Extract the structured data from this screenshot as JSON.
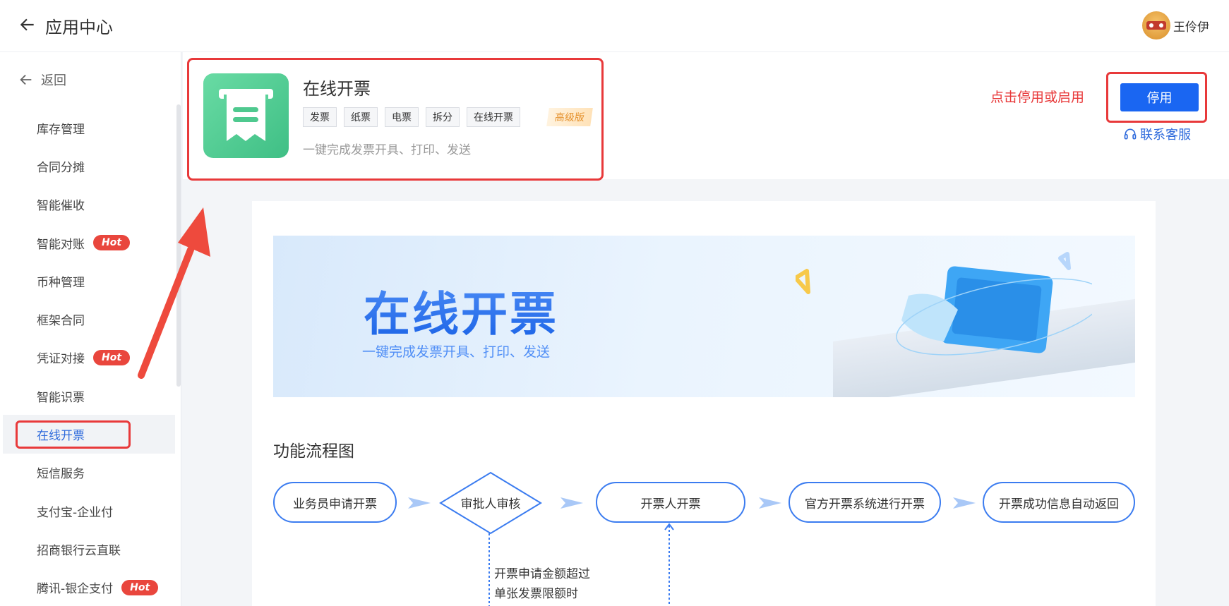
{
  "header": {
    "title": "应用中心",
    "user_name": "王伶伊"
  },
  "sidebar": {
    "back_label": "返回",
    "items": [
      {
        "label": "库存管理",
        "hot": ""
      },
      {
        "label": "合同分摊",
        "hot": ""
      },
      {
        "label": "智能催收",
        "hot": ""
      },
      {
        "label": "智能对账",
        "hot": "Hot"
      },
      {
        "label": "币种管理",
        "hot": ""
      },
      {
        "label": "框架合同",
        "hot": ""
      },
      {
        "label": "凭证对接",
        "hot": "Hot"
      },
      {
        "label": "智能识票",
        "hot": ""
      },
      {
        "label": "在线开票",
        "hot": ""
      },
      {
        "label": "短信服务",
        "hot": ""
      },
      {
        "label": "支付宝-企业付",
        "hot": ""
      },
      {
        "label": "招商银行云直联",
        "hot": ""
      },
      {
        "label": "腾讯-银企支付",
        "hot": "Hot"
      }
    ],
    "active_index": 8
  },
  "app": {
    "name": "在线开票",
    "tags": [
      "发票",
      "纸票",
      "电票",
      "拆分",
      "在线开票"
    ],
    "level": "高级版",
    "description": "一键完成发票开具、打印、发送",
    "hint": "点击停用或启用",
    "stop_label": "停用",
    "service_label": "联系客服"
  },
  "banner": {
    "title": "在线开票",
    "subtitle": "一键完成发票开具、打印、发送"
  },
  "flow": {
    "title": "功能流程图",
    "nodes": [
      "业务员申请开票",
      "审批人审核",
      "开票人开票",
      "官方开票系统进行开票",
      "开票成功信息自动返回"
    ],
    "note_lines": [
      "开票申请金额超过",
      "单张发票限额时"
    ]
  },
  "colors": {
    "accent": "#1a66f2",
    "annotation_red": "#e8393a",
    "hot_badge": "#e9463d",
    "app_icon": "#4ccb91"
  }
}
